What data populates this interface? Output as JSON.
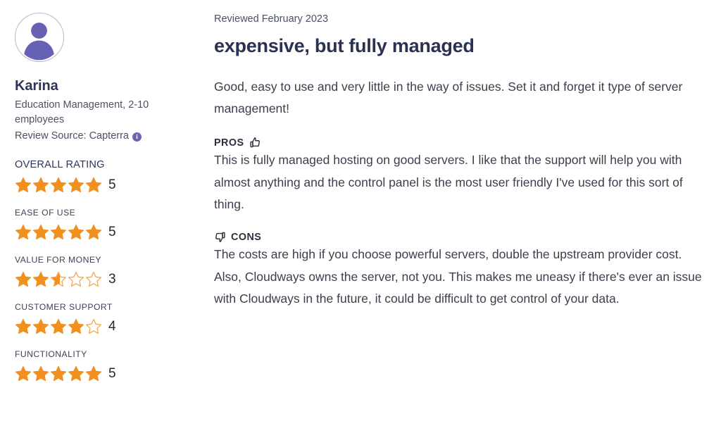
{
  "reviewer": {
    "avatar_icon": "user-avatar-icon",
    "name": "Karina",
    "industry_and_size": "Education Management, 2-10 employees",
    "review_source": "Review Source: Capterra",
    "info_icon": "info-icon",
    "info_glyph": "i"
  },
  "ratings": [
    {
      "label": "OVERALL RATING",
      "value": "5",
      "stars": 5
    },
    {
      "label": "EASE OF USE",
      "value": "5",
      "stars": 5
    },
    {
      "label": "VALUE FOR MONEY",
      "value": "3",
      "stars": 2.6
    },
    {
      "label": "CUSTOMER SUPPORT",
      "value": "4",
      "stars": 4
    },
    {
      "label": "FUNCTIONALITY",
      "value": "5",
      "stars": 5
    }
  ],
  "review": {
    "reviewed_date": "Reviewed February 2023",
    "title": "expensive, but fully managed",
    "summary": "Good, easy to use and very little in the way of issues. Set it and forget it type of server management!",
    "pros": {
      "label": "PROS",
      "icon": "thumbs-up-icon",
      "text": "This is fully managed hosting on good servers. I like that the support will help you with almost anything and the control panel is the most user friendly I've used for this sort of thing."
    },
    "cons": {
      "label": "CONS",
      "icon": "thumbs-down-icon",
      "text": "The costs are high if you choose powerful servers, double the upstream provider cost. Also, Cloudways owns the server, not you. This makes me uneasy if there's ever an issue with Cloudways in the future, it could be difficult to get control of your data."
    }
  },
  "colors": {
    "star_filled": "#f2901f",
    "star_empty_outline": "#f2a94e",
    "avatar_purple": "#6761b3",
    "title_navy": "#2b3152",
    "body_gray": "#3a3f4b"
  }
}
